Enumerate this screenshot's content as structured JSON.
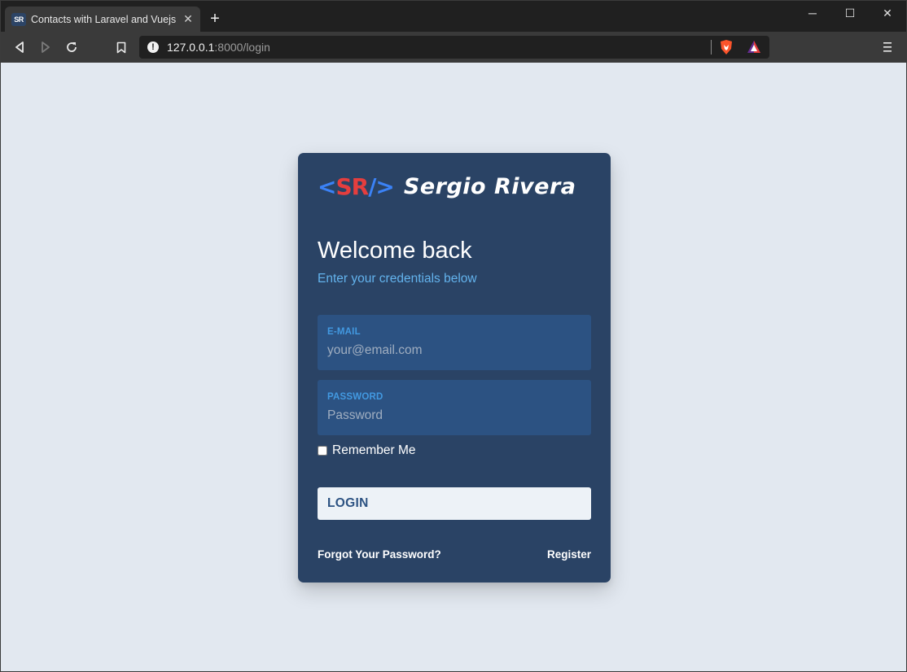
{
  "browser": {
    "tab": {
      "favicon_text": "SR",
      "title": "Contacts with Laravel and Vuejs",
      "close_glyph": "✕"
    },
    "new_tab_glyph": "+",
    "window_controls": {
      "minimize_glyph": "─",
      "maximize_glyph": "☐",
      "close_glyph": "✕"
    },
    "address": {
      "host": "127.0.0.1",
      "rest": ":8000/login",
      "info_glyph": "!"
    },
    "icons": [
      "back-icon",
      "forward-icon",
      "reload-icon",
      "bookmark-icon",
      "site-info-icon",
      "brave-shields-icon",
      "brave-rewards-icon",
      "menu-icon"
    ]
  },
  "login_card": {
    "logo": {
      "open_bracket": "<",
      "initials": "SR",
      "close_bracket": "/>",
      "name": "Sergio Rivera"
    },
    "heading": "Welcome back",
    "subheading": "Enter your credentials below",
    "email": {
      "label": "E-MAIL",
      "value": "",
      "placeholder": "your@email.com"
    },
    "password": {
      "label": "PASSWORD",
      "value": "",
      "placeholder": "Password"
    },
    "remember": {
      "label": "Remember Me",
      "checked": false
    },
    "login_button": "LOGIN",
    "forgot_link": "Forgot Your Password?",
    "register_link": "Register"
  },
  "colors": {
    "page_bg": "#e2e8f0",
    "card_bg": "#2a4365",
    "field_bg": "#2c5282",
    "field_label": "#4299e1",
    "subtitle": "#63b3ed",
    "logo_red": "#e53e3e",
    "logo_blue": "#3b82f6"
  }
}
